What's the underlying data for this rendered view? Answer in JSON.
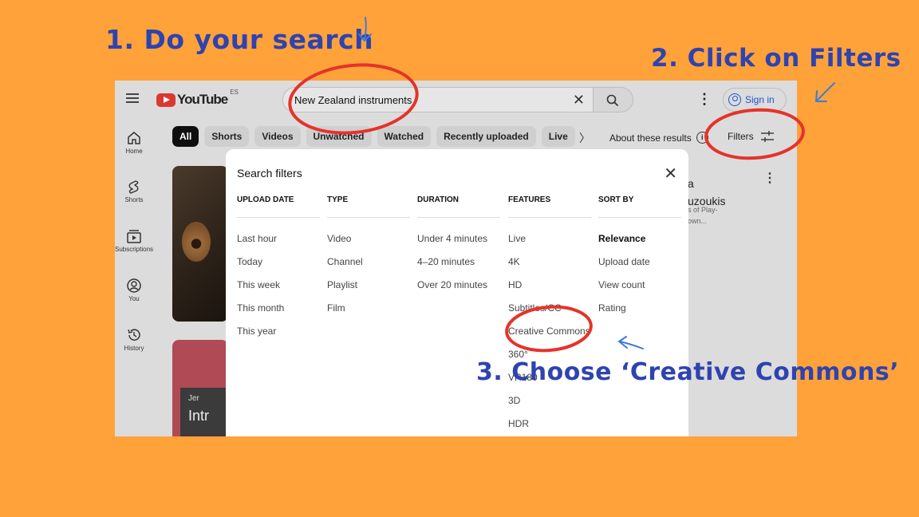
{
  "annotations": {
    "step1": "1. Do your search",
    "step2": "2. Click on Filters",
    "step3": "3. Choose ‘Creative Commons’"
  },
  "header": {
    "logo_text": "YouTube",
    "logo_region": "ES",
    "search_value": "New Zealand instruments",
    "sign_in": "Sign in"
  },
  "chips": [
    "All",
    "Shorts",
    "Videos",
    "Unwatched",
    "Watched",
    "Recently uploaded",
    "Live"
  ],
  "toolbar": {
    "about": "About these results",
    "filters": "Filters"
  },
  "sidebar": {
    "items": [
      {
        "label": "Home",
        "icon": "home-icon"
      },
      {
        "label": "Shorts",
        "icon": "shorts-icon"
      },
      {
        "label": "Subscriptions",
        "icon": "subscriptions-icon"
      },
      {
        "label": "You",
        "icon": "you-icon"
      },
      {
        "label": "History",
        "icon": "history-icon"
      }
    ]
  },
  "results": {
    "title_line1": "a",
    "title_line2": "uzoukis",
    "meta_line1": "s of Play-",
    "meta_line2": "own...",
    "thumb2_small": "Jer",
    "thumb2_large": "Intr"
  },
  "dialog": {
    "title": "Search filters",
    "columns": [
      {
        "heading": "UPLOAD DATE",
        "items": [
          "Last hour",
          "Today",
          "This week",
          "This month",
          "This year"
        ]
      },
      {
        "heading": "TYPE",
        "items": [
          "Video",
          "Channel",
          "Playlist",
          "Film"
        ]
      },
      {
        "heading": "DURATION",
        "items": [
          "Under 4 minutes",
          "4–20 minutes",
          "Over 20 minutes"
        ]
      },
      {
        "heading": "FEATURES",
        "items": [
          "Live",
          "4K",
          "HD",
          "Subtitles/CC",
          "Creative Commons",
          "360°",
          "VR180",
          "3D",
          "HDR"
        ]
      },
      {
        "heading": "SORT BY",
        "items": [
          "Relevance",
          "Upload date",
          "View count",
          "Rating"
        ]
      }
    ]
  },
  "colors": {
    "background": "#FFA23A",
    "annotation_text": "#2F43B0",
    "highlight_circle": "#E5332A",
    "arrow": "#3D7BD9"
  }
}
